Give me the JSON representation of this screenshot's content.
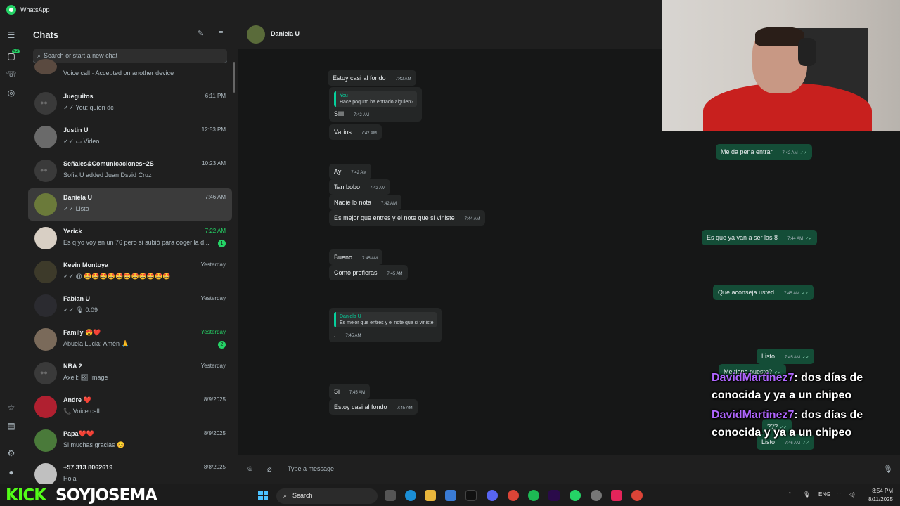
{
  "app": {
    "title": "WhatsApp"
  },
  "sidebar": {
    "heading": "Chats",
    "search_placeholder": "Search or start a new chat",
    "rail_badge": "62",
    "chats": [
      {
        "name": "",
        "preview": "Voice call · Accepted on another device",
        "time": "",
        "group": false
      },
      {
        "name": "Jueguitos",
        "preview": "✓✓ You: quien dc",
        "time": "6:11 PM",
        "group": true
      },
      {
        "name": "Justin U",
        "preview": "✓✓ ▭ Video",
        "time": "12:53 PM",
        "group": false
      },
      {
        "name": "Señales&Comunicaciones~2S",
        "preview": "Sofia U added Juan Dsvid Cruz",
        "time": "10:23 AM",
        "group": true
      },
      {
        "name": "Daniela U",
        "preview": "✓✓ Listo",
        "time": "7:46 AM",
        "group": false,
        "selected": true
      },
      {
        "name": "Yerick",
        "preview": "Es q yo voy en un 76 pero si subió para coger la d...",
        "time": "7:22 AM",
        "group": false,
        "unread": "1"
      },
      {
        "name": "Kevin Montoya",
        "preview": "✓✓ @ 🤩🤩🤩🤩🤩🤩🤩🤩🤩🤩🤩",
        "time": "Yesterday",
        "group": false
      },
      {
        "name": "Fabian U",
        "preview": "✓✓ 🎙 0:09",
        "time": "Yesterday",
        "group": false
      },
      {
        "name": "Family 😍❤️",
        "preview": "Abuela Lucia: Amén 🙏",
        "time": "Yesterday",
        "group": false,
        "unread": "2"
      },
      {
        "name": "NBA 2",
        "preview": "Axell: 🖼 Image",
        "time": "Yesterday",
        "group": true
      },
      {
        "name": "Andre ❤️",
        "preview": "📞 Voice call",
        "time": "8/9/2025",
        "group": false
      },
      {
        "name": "Papa❤️❤️",
        "preview": "Si muchas gracias ☺️",
        "time": "8/9/2025",
        "group": false
      },
      {
        "name": "+57 313 8062619",
        "preview": "Hola",
        "time": "8/8/2025",
        "group": false
      }
    ]
  },
  "conversation": {
    "contact": "Daniela U",
    "compose_placeholder": "Type a message",
    "messages": [
      {
        "dir": "in",
        "text": "Estoy casi al fondo",
        "time": "7:42 AM"
      },
      {
        "dir": "in",
        "quote_who": "You",
        "quote_text": "Hace poquito ha entrado alguien?",
        "text": "Siiii",
        "time": "7:42 AM"
      },
      {
        "dir": "in",
        "text": "Varios",
        "time": "7:42 AM"
      },
      {
        "dir": "out",
        "text": "Me da pena entrar",
        "time": "7:42 AM"
      },
      {
        "dir": "in",
        "text": "Ay",
        "time": "7:42 AM"
      },
      {
        "dir": "in",
        "text": "Tan bobo",
        "time": "7:42 AM"
      },
      {
        "dir": "in",
        "text": "Nadie lo nota",
        "time": "7:42 AM"
      },
      {
        "dir": "in",
        "text": "Es mejor que entres y el note que si viniste",
        "time": "7:44 AM"
      },
      {
        "dir": "out",
        "text": "Es que ya van a ser las 8",
        "time": "7:44 AM"
      },
      {
        "dir": "in",
        "text": "Bueno",
        "time": "7:45 AM"
      },
      {
        "dir": "in",
        "text": "Como prefieras",
        "time": "7:45 AM"
      },
      {
        "dir": "out",
        "text": "Que aconseja usted",
        "time": "7:45 AM"
      },
      {
        "dir": "in",
        "quote_who": "Daniela U",
        "quote_text": "Es mejor que entres y el note que si viniste",
        "text": ".",
        "time": "7:45 AM"
      },
      {
        "dir": "out",
        "text": "Listo",
        "time": "7:45 AM"
      },
      {
        "dir": "out",
        "text": "Me tiene puesto?",
        "time": ""
      },
      {
        "dir": "in",
        "text": "Si",
        "time": "7:45 AM"
      },
      {
        "dir": "in",
        "text": "Estoy casi al fondo",
        "time": "7:45 AM"
      },
      {
        "dir": "out",
        "text": "???",
        "time": ""
      },
      {
        "dir": "out",
        "text": "Listo",
        "time": "7:46 AM"
      }
    ]
  },
  "stream_overlay": [
    {
      "user": "DavidMartinez7",
      "msg": ": dos días de conocida y ya a un chipeo"
    },
    {
      "user": "DavidMartinez7",
      "msg": ": dos días de conocida y ya a un chipeo"
    }
  ],
  "stream_brand": {
    "platform": "KICK",
    "channel": "SOYJOSEMA",
    "color": "#53fc18"
  },
  "taskbar": {
    "search_label": "Search",
    "lang": "ENG",
    "time": "8:54 PM",
    "date": "8/11/2025"
  },
  "colors": {
    "accent": "#25d366",
    "outgoing": "#144d37",
    "incoming": "#242626",
    "bg": "#161717"
  }
}
